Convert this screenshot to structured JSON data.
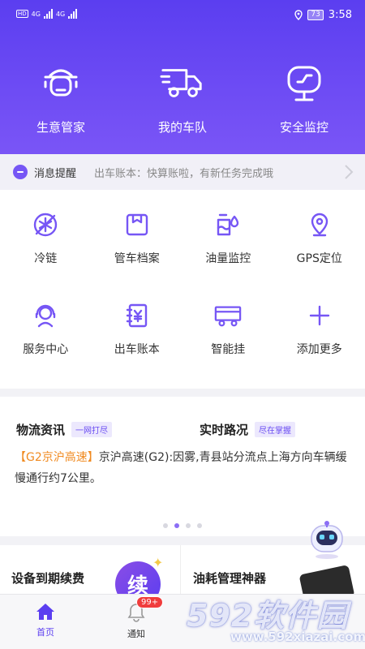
{
  "status_bar": {
    "battery": "73",
    "time": "3:58",
    "net_1": "4G",
    "net_2": "4G",
    "hd": "HD"
  },
  "top_menu": [
    {
      "label": "生意管家",
      "icon": "manager-icon"
    },
    {
      "label": "我的车队",
      "icon": "truck-icon"
    },
    {
      "label": "安全监控",
      "icon": "monitor-icon"
    }
  ],
  "notice": {
    "title": "消息提醒",
    "text": "出车账本：快算账啦，有新任务完成哦"
  },
  "grid": [
    {
      "label": "冷链",
      "icon": "snowflake-icon"
    },
    {
      "label": "管车档案",
      "icon": "archive-icon"
    },
    {
      "label": "油量监控",
      "icon": "fuel-icon"
    },
    {
      "label": "GPS定位",
      "icon": "location-icon"
    },
    {
      "label": "服务中心",
      "icon": "service-icon"
    },
    {
      "label": "出车账本",
      "icon": "ledger-icon"
    },
    {
      "label": "智能挂",
      "icon": "trailer-icon"
    },
    {
      "label": "添加更多",
      "icon": "plus-icon"
    }
  ],
  "news": {
    "tab_1": "物流资讯",
    "tag_1": "一网打尽",
    "tab_2": "实时路况",
    "tag_2": "尽在掌握",
    "highlight": "【G2京沪高速】",
    "body": "京沪高速(G2):因雾,青县站分流点上海方向车辆缓慢通行约7公里。",
    "pages": 4,
    "active_page": 2
  },
  "cards": {
    "left": "设备到期续费",
    "renew": "续",
    "right": "油耗管理神器"
  },
  "tabbar": {
    "home": "首页",
    "notify": "通知",
    "badge": "99+"
  },
  "watermark": {
    "main": "592软件园",
    "url": "www.592xiazai.com"
  },
  "colors": {
    "primary": "#5b3ef0",
    "icon": "#7656f5",
    "highlight": "#f08a20",
    "badge": "#f03c3c"
  }
}
